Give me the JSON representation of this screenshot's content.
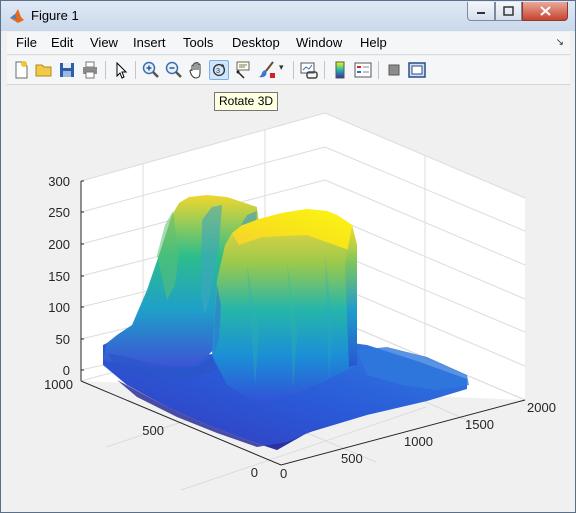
{
  "window": {
    "title": "Figure 1"
  },
  "menu": [
    "File",
    "Edit",
    "View",
    "Insert",
    "Tools",
    "Desktop",
    "Window",
    "Help"
  ],
  "toolbar": {
    "tools": [
      "new-figure",
      "open-file",
      "save",
      "print",
      "edit-plot",
      "zoom-in",
      "zoom-out",
      "pan",
      "rotate-3d",
      "data-cursor",
      "brush",
      "link-plot",
      "insert-colorbar",
      "insert-legend",
      "hide-plot-tools",
      "show-plot-tools"
    ],
    "tooltip": "Rotate 3D"
  },
  "chart_data": {
    "type": "surface",
    "colormap": "parula",
    "grid": true,
    "axes": {
      "x": {
        "range": [
          0,
          2000
        ],
        "ticks": [
          "0",
          "500",
          "1000",
          "1500",
          "2000"
        ]
      },
      "y": {
        "range": [
          0,
          1000
        ],
        "ticks": [
          "0",
          "500",
          "1000"
        ]
      },
      "z": {
        "range": [
          0,
          300
        ],
        "ticks": [
          "0",
          "50",
          "100",
          "150",
          "200",
          "250",
          "300"
        ]
      }
    },
    "features": [
      {
        "label": "background",
        "height": 20
      },
      {
        "label": "rear ridge",
        "height": 265
      },
      {
        "label": "plateau",
        "height": 245
      }
    ]
  }
}
